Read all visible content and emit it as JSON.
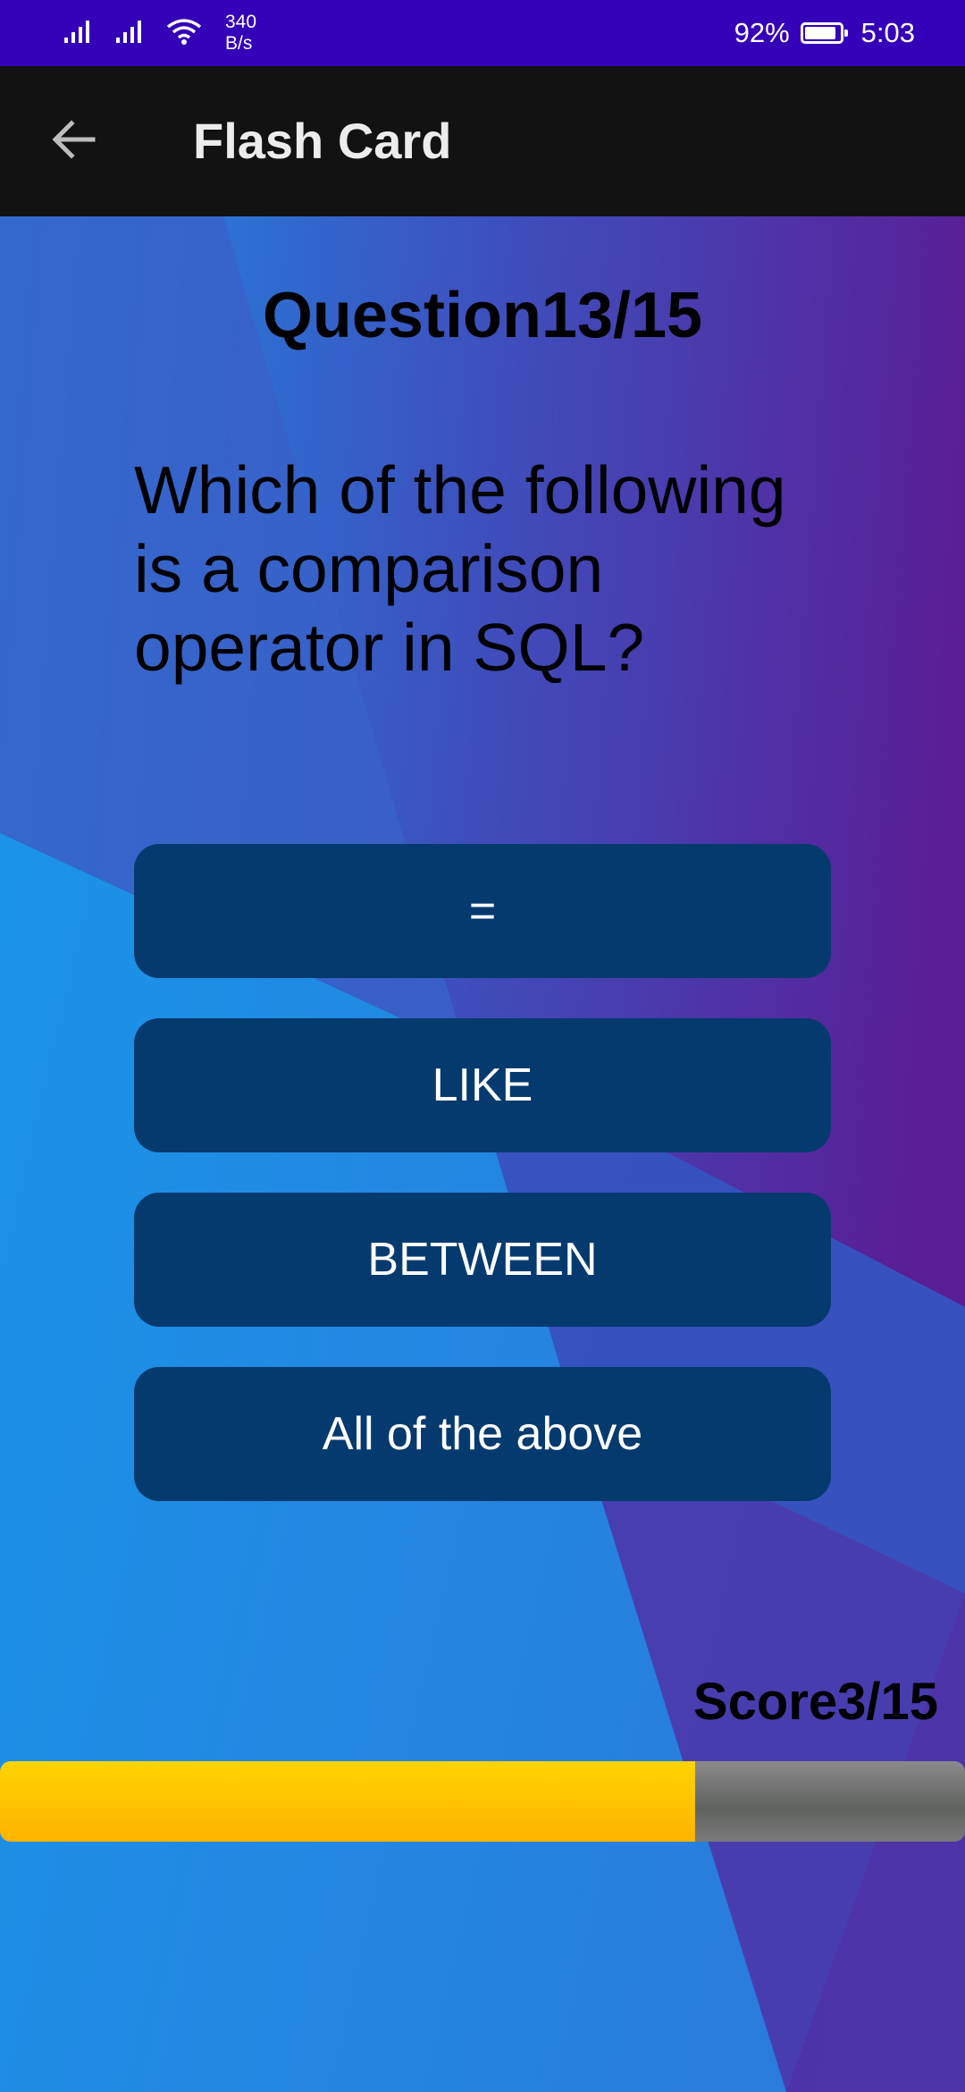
{
  "status_bar": {
    "net_speed_value": "340",
    "net_speed_unit": "B/s",
    "battery": "92%",
    "battery_level": 0.92,
    "time": "5:03",
    "icons": [
      "signal-icon",
      "signal-icon",
      "wifi-icon",
      "battery-icon"
    ]
  },
  "app_bar": {
    "title": "Flash Card",
    "back_icon": "arrow-back-icon"
  },
  "quiz": {
    "question_counter": "Question13/15",
    "question": "Which of the following is a comparison operator in SQL?",
    "options": [
      "=",
      "LIKE",
      "BETWEEN",
      "All of the above"
    ],
    "score": "Score3/15",
    "progress_fraction": 0.72
  },
  "colors": {
    "status_bar": "#3400b8",
    "app_bar": "#121212",
    "option_button": "#053a6f",
    "progress_fill": "#ffc200",
    "progress_track": "#6b6b6b",
    "bg_blue": "#1b90e8",
    "bg_purple": "#5a1e96"
  }
}
